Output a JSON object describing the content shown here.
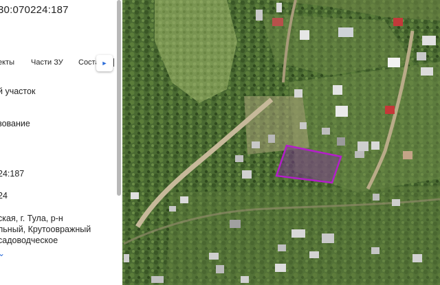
{
  "panel": {
    "cadastral_title": "30:070224:187",
    "tabs": [
      {
        "label": "екты"
      },
      {
        "label": "Части ЗУ"
      },
      {
        "label": "Соста"
      }
    ],
    "tab_scroll_icon": "chevron-right-icon",
    "fields": {
      "type": "й участок",
      "usage": "зование",
      "number": "24:187",
      "quarter": "24"
    },
    "address_lines": [
      "ская, г. Тула, р-н",
      "льный, Крутоовражный",
      "садоводческое"
    ],
    "expand_icon": "chevron-down-icon"
  },
  "map": {
    "parcel_outline_color": "#b31ec9",
    "parcel_fill_color": "#7a3d8c"
  }
}
